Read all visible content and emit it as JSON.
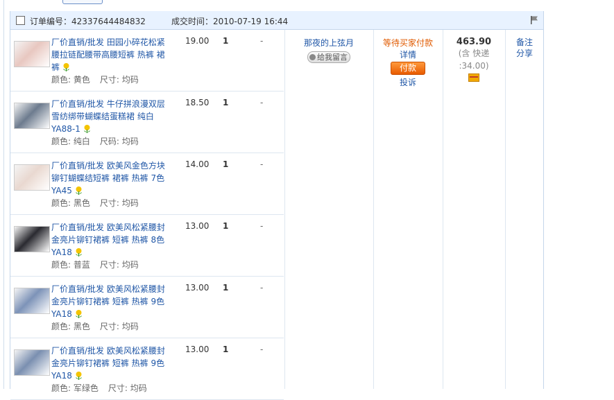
{
  "order": {
    "number_label": "订单编号：",
    "number": "42337644484832",
    "time_label": "成交时间：",
    "time": "2010-07-19 16:44",
    "buyer": {
      "name": "那夜的上弦月",
      "message_button": "给我留言"
    },
    "status": {
      "text": "等待买家付款",
      "detail": "详情",
      "pay_button": "付款",
      "complain": "投诉"
    },
    "total": {
      "amount": "463.90",
      "shipping_line1": "(含 快递",
      "shipping_line2": ":34.00)",
      "card_icon": "credit-card-icon"
    },
    "memo": {
      "line1": "备注",
      "line2": "分享"
    }
  },
  "items": [
    {
      "title": "厂价直销/批发 田园小碎花松紧腰拉链配腰带高腰短裤 热裤 裙裤",
      "color_label": "颜色:",
      "color": "黄色",
      "size_label": "尺寸:",
      "size": "均码",
      "price": "19.00",
      "qty": "1",
      "extra": "-",
      "thumb_color": "#e8c7c0"
    },
    {
      "title": "厂价直销/批发 牛仔拼浪漫双层雪纺绑带蝴蝶结蛋糕裙 纯白YA88-1",
      "color_label": "颜色:",
      "color": "纯白",
      "size_label": "尺码:",
      "size": "均码",
      "price": "18.50",
      "qty": "1",
      "extra": "-",
      "thumb_color": "#6d7b8e"
    },
    {
      "title": "厂价直销/批发 欧美风金色方块铆钉蝴蝶结短裤 裙裤 热裤 7色YA45",
      "color_label": "颜色:",
      "color": "黑色",
      "size_label": "尺寸:",
      "size": "均码",
      "price": "14.00",
      "qty": "1",
      "extra": "-",
      "thumb_color": "#e9d8d0"
    },
    {
      "title": "厂价直销/批发 欧美风松紧腰封金亮片铆钉裙裤 短裤 热裤 8色YA18",
      "color_label": "颜色:",
      "color": "普蓝",
      "size_label": "尺寸:",
      "size": "均码",
      "price": "13.00",
      "qty": "1",
      "extra": "-",
      "thumb_color": "#2a2a30"
    },
    {
      "title": "厂价直销/批发 欧美风松紧腰封金亮片铆钉裙裤 短裤 热裤 9色YA18",
      "color_label": "颜色:",
      "color": "黑色",
      "size_label": "尺寸:",
      "size": "均码",
      "price": "13.00",
      "qty": "1",
      "extra": "-",
      "thumb_color": "#7d93b8"
    },
    {
      "title": "厂价直销/批发 欧美风松紧腰封金亮片铆钉裙裤 短裤 热裤 9色YA18",
      "color_label": "颜色:",
      "color": "军绿色",
      "size_label": "尺寸:",
      "size": "均码",
      "price": "13.00",
      "qty": "1",
      "extra": "-",
      "thumb_color": "#7a8fb0"
    }
  ],
  "colors": {
    "link": "#1f56a6",
    "status": "#e05a00",
    "header_bg": "#e8f2ff"
  },
  "icons": {
    "flag": "flag-icon",
    "product": "flower-icon"
  }
}
